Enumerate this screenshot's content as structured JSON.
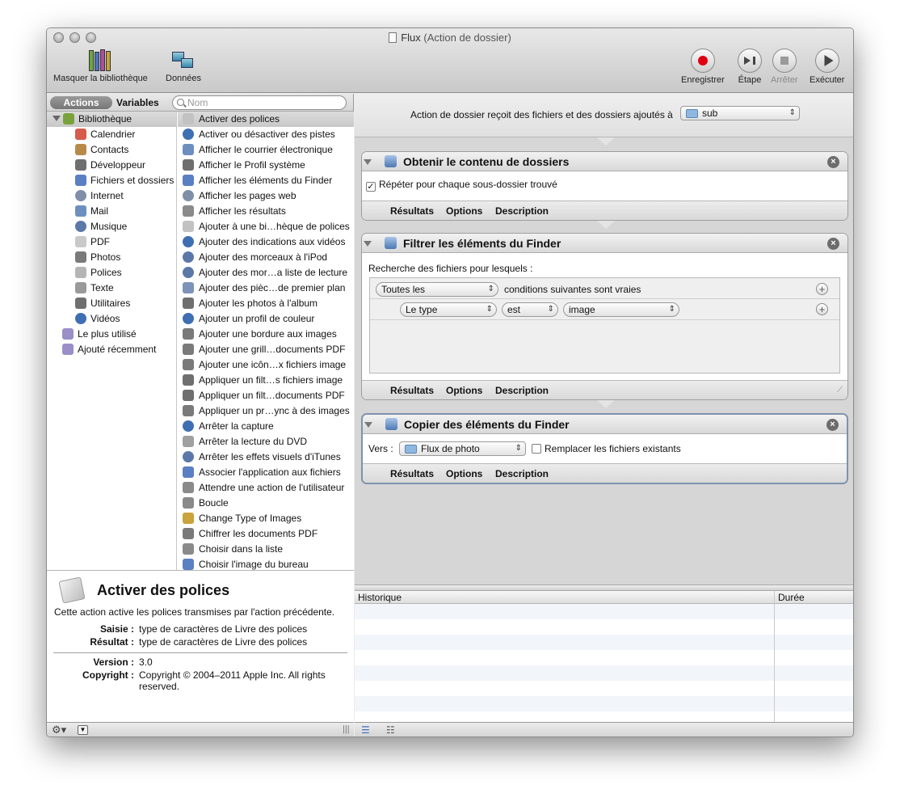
{
  "window": {
    "title": "Flux",
    "subtitle": "(Action de dossier)"
  },
  "toolbar": {
    "library_label": "Masquer la bibliothèque",
    "data_label": "Données",
    "record_label": "Enregistrer",
    "step_label": "Étape",
    "stop_label": "Arrêter",
    "run_label": "Exécuter"
  },
  "library": {
    "tab_actions": "Actions",
    "tab_variables": "Variables",
    "search_placeholder": "Nom",
    "items": [
      {
        "label": "Bibliothèque",
        "color": "#7aa23c"
      },
      {
        "label": "Calendrier",
        "color": "#d65b4b"
      },
      {
        "label": "Contacts",
        "color": "#b88a4a"
      },
      {
        "label": "Développeur",
        "color": "#6f6f6f"
      },
      {
        "label": "Fichiers et dossiers",
        "color": "#5a7fc2"
      },
      {
        "label": "Internet",
        "color": "#7f8fa8"
      },
      {
        "label": "Mail",
        "color": "#6d8fbf"
      },
      {
        "label": "Musique",
        "color": "#5b78a8"
      },
      {
        "label": "PDF",
        "color": "#c9c9c9"
      },
      {
        "label": "Photos",
        "color": "#7a7a7a"
      },
      {
        "label": "Polices",
        "color": "#b5b5b5"
      },
      {
        "label": "Texte",
        "color": "#9a9a9a"
      },
      {
        "label": "Utilitaires",
        "color": "#6f6f6f"
      },
      {
        "label": "Vidéos",
        "color": "#3f6fb2"
      },
      {
        "label": "Le plus utilisé",
        "color": "#9a8fc8"
      },
      {
        "label": "Ajouté récemment",
        "color": "#9a8fc8"
      }
    ]
  },
  "actions_list": [
    "Activer des polices",
    "Activer ou désactiver des pistes",
    "Afficher le courrier électronique",
    "Afficher le Profil système",
    "Afficher les éléments du Finder",
    "Afficher les pages web",
    "Afficher les résultats",
    "Ajouter à une bi…hèque de polices",
    "Ajouter des indications aux vidéos",
    "Ajouter des morceaux à l'iPod",
    "Ajouter des mor…a liste de lecture",
    "Ajouter des pièc…de premier plan",
    "Ajouter les photos à l'album",
    "Ajouter un profil de couleur",
    "Ajouter une bordure aux images",
    "Ajouter une grill…documents PDF",
    "Ajouter une icôn…x fichiers image",
    "Appliquer un filt…s fichiers image",
    "Appliquer un filt…documents PDF",
    "Appliquer un pr…ync à des images",
    "Arrêter la capture",
    "Arrêter la lecture du DVD",
    "Arrêter les effets visuels d'iTunes",
    "Associer l'application aux fichiers",
    "Attendre une action de l'utilisateur",
    "Boucle",
    "Change Type of Images",
    "Chiffrer les documents PDF",
    "Choisir dans la liste",
    "Choisir l'image du bureau"
  ],
  "info": {
    "title": "Activer des polices",
    "description": "Cette action active les polices transmises par l'action précédente.",
    "input_key": "Saisie :",
    "input_value": "type de caractères de Livre des polices",
    "result_key": "Résultat :",
    "result_value": "type de caractères de Livre des polices",
    "version_key": "Version :",
    "version_value": "3.0",
    "copyright_key": "Copyright :",
    "copyright_value": "Copyright © 2004–2011 Apple Inc. All rights reserved."
  },
  "workflow": {
    "receives_label": "Action de dossier reçoit des fichiers et des dossiers ajoutés à",
    "receives_folder": "sub",
    "footer_results": "Résultats",
    "footer_options": "Options",
    "footer_description": "Description",
    "action1": {
      "title": "Obtenir le contenu de dossiers",
      "checkbox_label": "Répéter pour chaque sous-dossier trouvé"
    },
    "action2": {
      "title": "Filtrer les éléments du Finder",
      "search_label": "Recherche des fichiers pour lesquels :",
      "match_popup": "Toutes les",
      "match_text": "conditions suivantes sont vraies",
      "criterion_field": "Le type",
      "criterion_op": "est",
      "criterion_value": "image"
    },
    "action3": {
      "title": "Copier des éléments du Finder",
      "dest_label": "Vers :",
      "dest_folder": "Flux de photo",
      "replace_label": "Remplacer les fichiers existants"
    }
  },
  "log": {
    "col_history": "Historique",
    "col_duration": "Durée"
  }
}
